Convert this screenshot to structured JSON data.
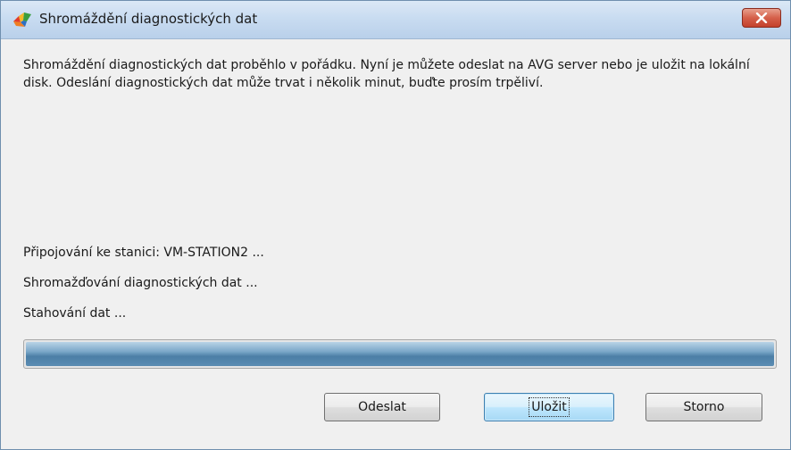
{
  "window": {
    "title": "Shromáždění diagnostických dat",
    "icon": "avg-logo-icon",
    "close_icon": "close-icon"
  },
  "message": "Shromáždění diagnostických dat proběhlo v pořádku. Nyní je můžete odeslat na AVG server nebo je uložit na lokální disk. Odeslání diagnostických dat může trvat i několik minut, buďte prosím trpěliví.",
  "status_lines": [
    "Připojování ke stanici: VM-STATION2 ...",
    "Shromažďování diagnostických dat ...",
    "Stahování dat ..."
  ],
  "progress": {
    "value": 1.0
  },
  "buttons": {
    "send": "Odeslat",
    "save": "Uložit",
    "cancel": "Storno"
  },
  "colors": {
    "titlebar": "#c9dcf1",
    "close": "#c3412c",
    "progress": "#4b7ea6",
    "default_button_border": "#3c7fb1"
  }
}
